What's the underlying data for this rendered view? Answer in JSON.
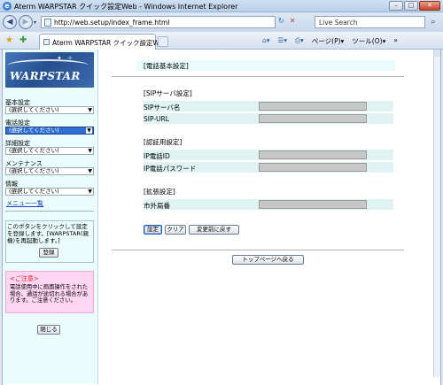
{
  "window": {
    "title": "Aterm WARPSTAR クイック設定Web - Windows Internet Explorer",
    "buttons": {
      "minimize": "–",
      "maximize": "□",
      "close": "✕"
    }
  },
  "addressbar": {
    "url": "http://web.setup/index_frame.html",
    "search_placeholder": "Live Search"
  },
  "commandbar": {
    "tab_label": "Aterm WARPSTAR クイック設定Web",
    "page_menu": "ページ(P)",
    "tools_menu": "ツール(O)"
  },
  "sidebar": {
    "logo_text": "WARPSTAR",
    "groups": [
      {
        "label": "基本設定",
        "selected": "(選択してください)"
      },
      {
        "label": "電話設定",
        "selected": "(選択してください)"
      },
      {
        "label": "詳細設定",
        "selected": "(選択してください)"
      },
      {
        "label": "メンテナンス",
        "selected": "(選択してください)"
      },
      {
        "label": "情報",
        "selected": "(選択してください)"
      }
    ],
    "menu_list_link": "メニュー一覧",
    "note": "このボタンをクリックして設定を登録します。[WARPSTAR(親機)を再起動します。]",
    "register_button": "登録",
    "caution_title": "<ご注意>",
    "caution_text": "電話使用中に画面操作をされた場合、通話が途切れる場合があります。ご注意ください。",
    "close_button": "閉じる"
  },
  "main": {
    "page_title": "[電話基本設定]",
    "sections": [
      {
        "title": "[SIPサーバ設定]",
        "rows": [
          "SIPサーバ名",
          "SIP-URL"
        ]
      },
      {
        "title": "[認証用設定]",
        "rows": [
          "IP電話ID",
          "IP電話パスワード"
        ]
      },
      {
        "title": "[拡張設定]",
        "rows": [
          "市外局番"
        ]
      }
    ],
    "buttons": {
      "set": "設定",
      "clear": "クリア",
      "revert": "変更前に戻す"
    },
    "top_page_button": "トップページへ戻る"
  }
}
